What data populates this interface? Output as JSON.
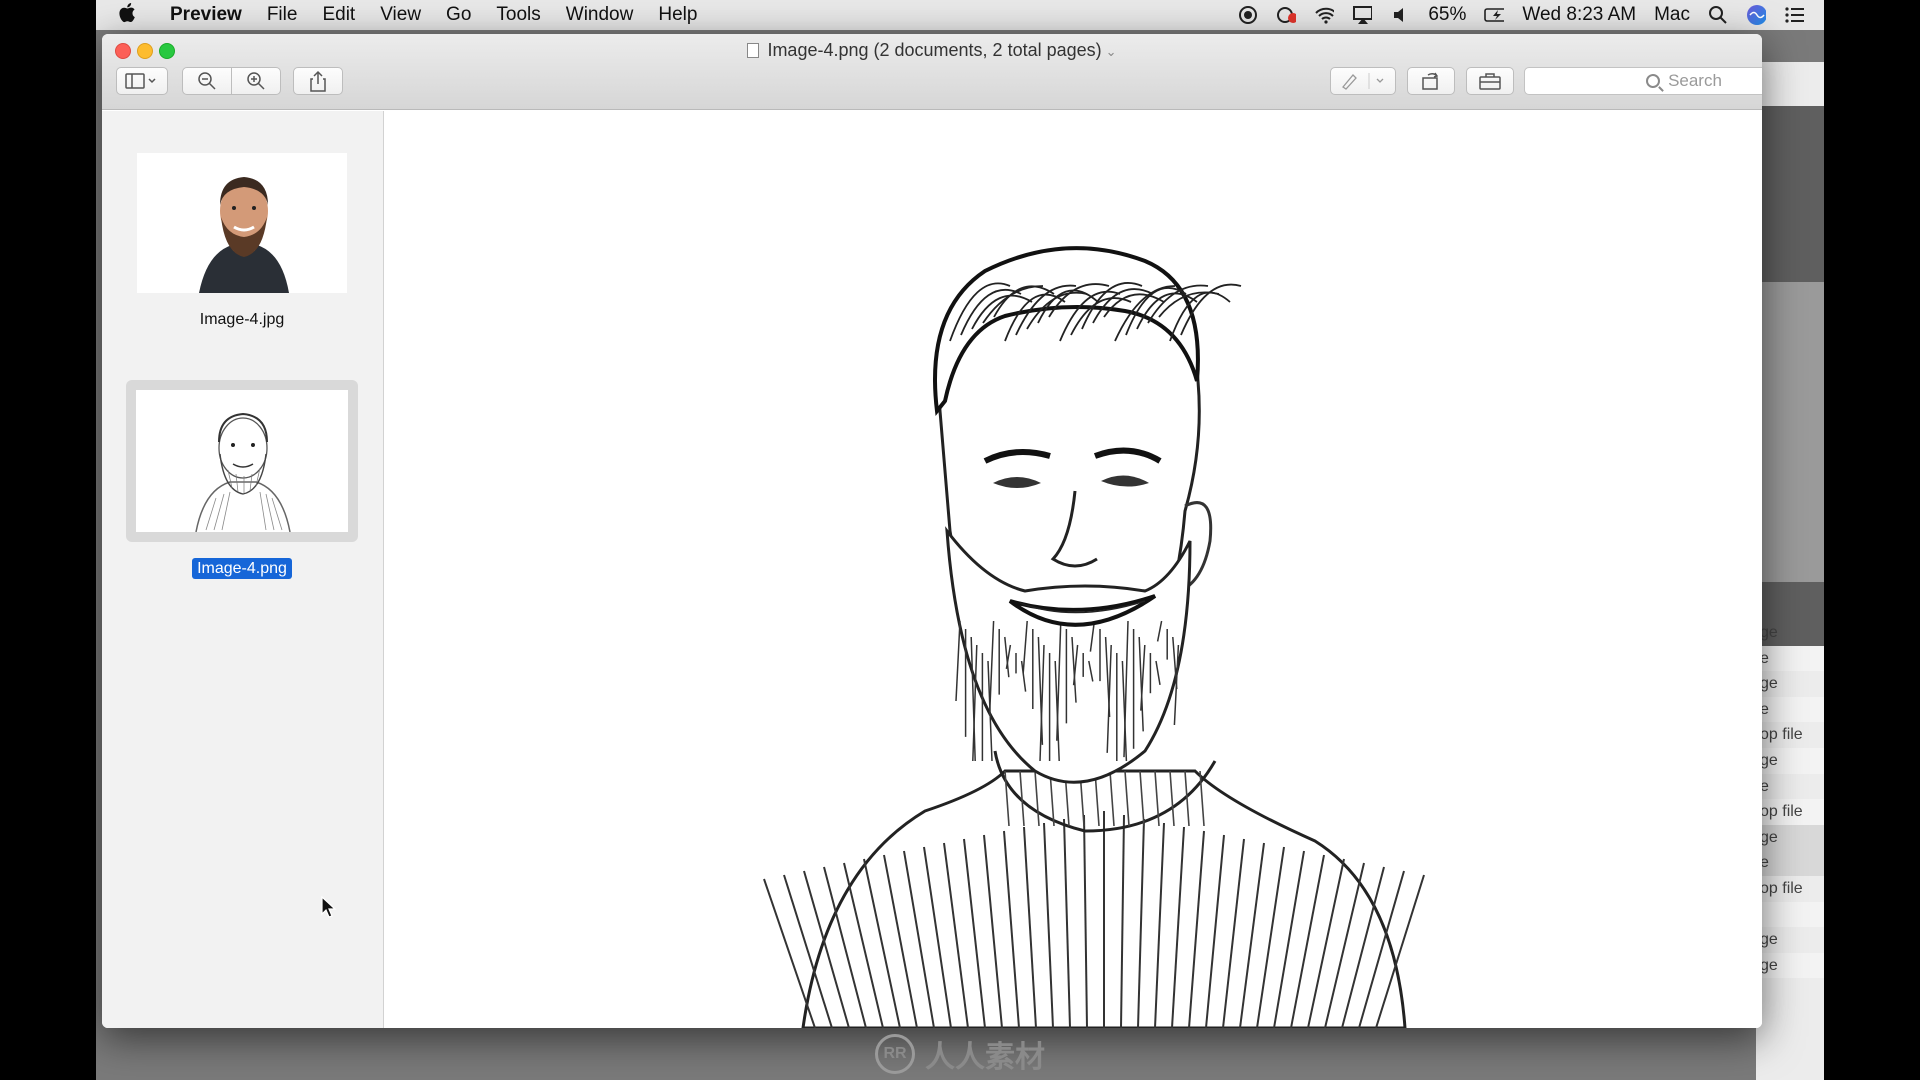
{
  "menubar": {
    "app_name": "Preview",
    "items": [
      "File",
      "Edit",
      "View",
      "Go",
      "Tools",
      "Window",
      "Help"
    ],
    "battery": "65%",
    "datetime": "Wed 8:23 AM",
    "user": "Mac"
  },
  "window": {
    "title": "Image-4.png (2 documents, 2 total pages)",
    "search_placeholder": "Search"
  },
  "sidebar": {
    "items": [
      {
        "label": "Image-4.jpg",
        "selected": false
      },
      {
        "label": "Image-4.png",
        "selected": true
      }
    ]
  },
  "background_list": [
    "ge",
    "e",
    "ge",
    "e",
    "op file",
    "ge",
    "e",
    "op file",
    "ge",
    "e",
    "op file",
    "",
    "ge",
    "ge"
  ],
  "watermark": {
    "bottom_text": "人人素材",
    "logo": "RR"
  },
  "colors": {
    "selection": "#1666d8",
    "close": "#fc5f57",
    "minimize": "#fdbc2e",
    "maximize": "#28c840"
  }
}
